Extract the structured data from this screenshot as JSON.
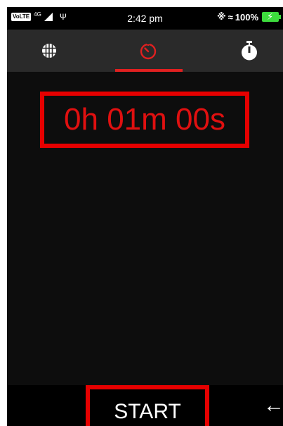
{
  "status_bar": {
    "volte": "VoLTE",
    "network": "4G",
    "time": "2:42 pm",
    "battery_percent": "100%",
    "battery_level": 1.0,
    "battery_color": "#3ddc3d",
    "icons": [
      "signal-icon",
      "usb-icon",
      "bluetooth-icon",
      "vibrate-icon",
      "battery-icon"
    ]
  },
  "tabs": [
    {
      "name": "world-clock",
      "icon": "globe-icon",
      "selected": false
    },
    {
      "name": "timer",
      "icon": "timer-icon",
      "selected": true
    },
    {
      "name": "stopwatch",
      "icon": "stopwatch-icon",
      "selected": false
    }
  ],
  "timer": {
    "display": "0h 01m 00s"
  },
  "bottom": {
    "start_label": "START",
    "back_icon": "back-arrow-icon"
  },
  "colors": {
    "accent": "#e01010",
    "highlight_border": "#e60000",
    "background": "#0d0d0d",
    "tab_bar": "#2a2a2a"
  }
}
